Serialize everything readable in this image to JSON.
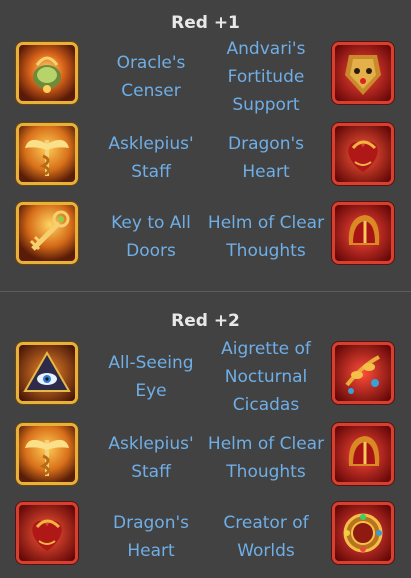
{
  "sections": [
    {
      "title": "Red +1",
      "rows": [
        {
          "left": {
            "icon": "oracles-censer-icon",
            "frame": "gold",
            "name": [
              "Oracle's",
              "Censer"
            ]
          },
          "right": {
            "icon": "andvaris-fortitude-support-icon",
            "frame": "red",
            "name": [
              "Andvari's",
              "Fortitude",
              "Support"
            ]
          }
        },
        {
          "left": {
            "icon": "asklepius-staff-icon",
            "frame": "gold",
            "name": [
              "Asklepius'",
              "Staff"
            ]
          },
          "right": {
            "icon": "dragons-heart-icon",
            "frame": "red",
            "name": [
              "Dragon's",
              "Heart"
            ]
          }
        },
        {
          "left": {
            "icon": "key-to-all-doors-icon",
            "frame": "gold",
            "name": [
              "Key to All",
              "Doors"
            ]
          },
          "right": {
            "icon": "helm-of-clear-thoughts-icon",
            "frame": "red",
            "name": [
              "Helm of Clear",
              "Thoughts"
            ]
          }
        }
      ]
    },
    {
      "title": "Red +2",
      "rows": [
        {
          "left": {
            "icon": "all-seeing-eye-icon",
            "frame": "gold",
            "name": [
              "All-Seeing",
              "Eye"
            ]
          },
          "right": {
            "icon": "aigrette-of-nocturnal-cicadas-icon",
            "frame": "red",
            "name": [
              "Aigrette of",
              "Nocturnal",
              "Cicadas"
            ]
          }
        },
        {
          "left": {
            "icon": "asklepius-staff-icon",
            "frame": "gold",
            "name": [
              "Asklepius'",
              "Staff"
            ]
          },
          "right": {
            "icon": "helm-of-clear-thoughts-icon",
            "frame": "red",
            "name": [
              "Helm of Clear",
              "Thoughts"
            ]
          }
        },
        {
          "left": {
            "icon": "dragons-heart-icon",
            "frame": "red",
            "name": [
              "Dragon's",
              "Heart"
            ]
          },
          "right": {
            "icon": "creator-of-worlds-icon",
            "frame": "red",
            "name": [
              "Creator of",
              "Worlds"
            ]
          }
        }
      ]
    }
  ]
}
